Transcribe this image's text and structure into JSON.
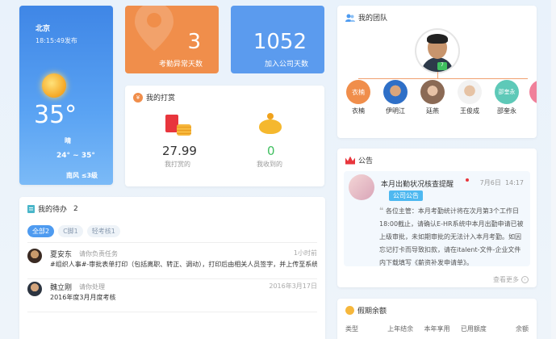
{
  "weather": {
    "city": "北京",
    "published": "18:15:49发布",
    "temperature": "35°",
    "condition": "晴",
    "range": "24° ~ 35°",
    "wind": "南风 ≤3级"
  },
  "stats": [
    {
      "value": "3",
      "label": "考勤异常天数",
      "color": "#f08e4b"
    },
    {
      "value": "1052",
      "label": "加入公司天数",
      "color": "#5b9bee"
    }
  ],
  "tips": {
    "title": "我的打赏",
    "given_value": "27.99",
    "given_label": "我打赏的",
    "received_value": "0",
    "received_label": "我收到的"
  },
  "todo": {
    "title": "我的待办",
    "count": "2",
    "filters": [
      "全部2",
      "C脚1",
      "轻考核1"
    ],
    "items": [
      {
        "name": "夏安东",
        "status": "请你负责任务",
        "time": "1小时前",
        "desc": "#组织人事#-审批表单打印（包括离职、转正、调动），打印后由相关人员签字，并上传至系统"
      },
      {
        "name": "魏立刚",
        "status": "请你处理",
        "time": "2016年3月17日",
        "desc": "2016年度3月月度考核"
      }
    ]
  },
  "team": {
    "title": "我的团队",
    "lead_tag": "7",
    "members": [
      {
        "name": "衣楠",
        "initials": "衣楠",
        "color": "#f08e4b"
      },
      {
        "name": "伊明江",
        "initials": "",
        "color": "#2e6fc7"
      },
      {
        "name": "廷燕",
        "initials": "",
        "color": "#b7a79a"
      },
      {
        "name": "王俊成",
        "initials": "",
        "color": "#d9c2a5"
      },
      {
        "name": "邵奎永",
        "initials": "邵奎永",
        "color": "#5ec9b8"
      }
    ]
  },
  "notice": {
    "title": "公告",
    "item_title": "本月出勤状况核查提醒",
    "date": "7月6日",
    "time": "14:17",
    "badge": "公司公告",
    "body": "各位主管：本月考勤统计将在次月第3个工作日18:00截止，请确认E-HR系统中本月出勤申请已被上级审批，未如期审批的无法计入本月考勤。如因忘记打卡而导致扣款，请在italent-文件-企业文件内下载填写《薪资补发申请单》。",
    "more": "查看更多",
    "accent": "#e8363d"
  },
  "leave": {
    "title": "假期余额",
    "columns": [
      "类型",
      "上年结余",
      "本年享用",
      "已用额度",
      "余额"
    ]
  }
}
